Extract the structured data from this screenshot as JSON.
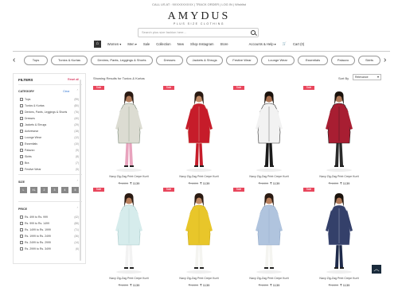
{
  "topbar": {
    "text": "CALL US AT : 9XXXXXXXXX  |  TRACK ORDER  |  LOG IN  |  Wishlist"
  },
  "brand": {
    "logo": "AMYDUS",
    "tagline": "PLUS SIZE CLOTHING"
  },
  "search": {
    "placeholder": "Search plus size fashion here..."
  },
  "nav": {
    "items": [
      "Women ▾",
      "Men ▾",
      "Sale",
      "Collection",
      "New",
      "Shop Instagram",
      "Store"
    ],
    "account": "Accounts & Help ▾",
    "cart": "Cart (0)"
  },
  "categories": [
    "Tops",
    "Tunics & Kurtas",
    "Denims, Pants, Leggings & Shorts",
    "Dresses",
    "Jackets & Shrugs",
    "Festive Wear",
    "Lounge Wear",
    "Essentials",
    "Palazzo",
    "Skirts"
  ],
  "filters": {
    "title": "FILTERS",
    "reset": "Reset all",
    "category_title": "CATEGORY",
    "category_clear": "Clear",
    "category_items": [
      {
        "label": "Tops",
        "count": "(99)"
      },
      {
        "label": "Tunics & Kurtas",
        "count": "(80)"
      },
      {
        "label": "Denims, Pants, Leggings & Shorts",
        "count": "(76)"
      },
      {
        "label": "Dresses",
        "count": "(40)"
      },
      {
        "label": "Jackets & Shrugs",
        "count": "(29)"
      },
      {
        "label": "Activewear",
        "count": "(18)"
      },
      {
        "label": "Lounge Wear",
        "count": "(12)"
      },
      {
        "label": "Essentials",
        "count": "(10)"
      },
      {
        "label": "Palazzo",
        "count": "(9)"
      },
      {
        "label": "Skirts",
        "count": "(8)"
      },
      {
        "label": "Bra",
        "count": "(7)"
      },
      {
        "label": "Festive Wear",
        "count": "(5)"
      }
    ],
    "size_title": "SIZE",
    "sizes": [
      "L",
      "XL",
      "2",
      "3",
      "4",
      "5"
    ],
    "price_title": "PRICE",
    "price_items": [
      {
        "label": "Rs. 499 to Rs. 999",
        "count": "(42)"
      },
      {
        "label": "Rs. 999 to Rs. 1499",
        "count": "(88)"
      },
      {
        "label": "Rs. 1499 to Rs. 1999",
        "count": "(71)"
      },
      {
        "label": "Rs. 1999 to Rs. 2499",
        "count": "(36)"
      },
      {
        "label": "Rs. 2499 to Rs. 2999",
        "count": "(14)"
      },
      {
        "label": "Rs. 2999 to Rs. 3499",
        "count": "(6)"
      }
    ]
  },
  "results": {
    "text": "Showing Results for Tunics & Kurtas",
    "sort_label": "Sort By",
    "sort_value": "Relevance"
  },
  "products": [
    {
      "badge": "Sale",
      "name": "Navy Zig-Zag Print Crepe Kurti",
      "old_price": "₹ 1899",
      "price": "₹ 1139",
      "dress_color": "#dcdcd2",
      "accent": "#7a8a7a",
      "pants": "#e8a3bd",
      "skin": "#b07a5a",
      "hair": "#2a1a12"
    },
    {
      "badge": "Sale",
      "name": "Navy Zig-Zag Print Crepe Kurti",
      "old_price": "₹ 1899",
      "price": "₹ 1139",
      "dress_color": "#c61c2a",
      "accent": "#e0d8c0",
      "pants": "#c61c2a",
      "skin": "#c08a66",
      "hair": "#2a1a12"
    },
    {
      "badge": "Sale",
      "name": "Navy Zig-Zag Print Crepe Kurti",
      "old_price": "₹ 1899",
      "price": "₹ 1139",
      "dress_color": "#f2f2f2",
      "accent": "#333333",
      "pants": "#1a1a1a",
      "skin": "#a87050",
      "hair": "#1a120c"
    },
    {
      "badge": "Sale",
      "name": "Navy Zig-Zag Print Crepe Kurti",
      "old_price": "₹ 1899",
      "price": "₹ 1139",
      "dress_color": "#a81e32",
      "accent": "#1a1a1a",
      "pants": "#2a2a2a",
      "skin": "#b07a5a",
      "hair": "#1a120c"
    },
    {
      "badge": "Sale",
      "name": "Navy Zig-Zag Print Crepe Kurti",
      "old_price": "₹ 1899",
      "price": "₹ 1139",
      "dress_color": "#d6ecec",
      "accent": "#a6c8c8",
      "pants": "#f2f2f2",
      "skin": "#b8805e",
      "hair": "#2a1a12"
    },
    {
      "badge": "Sale",
      "name": "Navy Zig-Zag Print Crepe Kurti",
      "old_price": "₹ 1899",
      "price": "₹ 1139",
      "dress_color": "#e8c62a",
      "accent": "#c8a818",
      "pants": "#f4f4f0",
      "skin": "#c08a66",
      "hair": "#2a1a12"
    },
    {
      "badge": "Sale",
      "name": "Navy Zig-Zag Print Crepe Kurti",
      "old_price": "₹ 1899",
      "price": "₹ 1139",
      "dress_color": "#b0c4de",
      "accent": "#8ea6c6",
      "pants": "#f4f4f0",
      "skin": "#b8805e",
      "hair": "#2a1a12"
    },
    {
      "badge": "Sale",
      "name": "Navy Zig-Zag Print Crepe Kurti",
      "old_price": "₹ 1899",
      "price": "₹ 1139",
      "dress_color": "#34406a",
      "accent": "#d8dce8",
      "pants": "#1e2a4a",
      "skin": "#b07a5a",
      "hair": "#1a120c"
    }
  ]
}
